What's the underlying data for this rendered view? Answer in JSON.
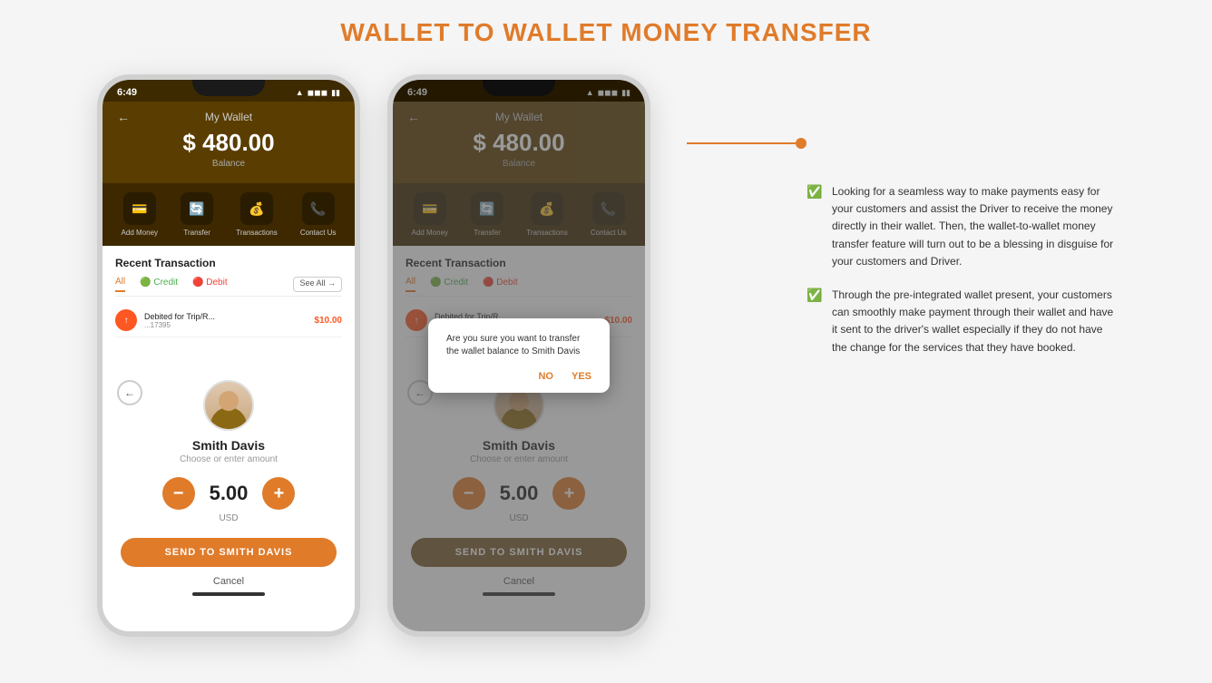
{
  "page": {
    "title": "WALLET TO WALLET MONEY TRANSFER"
  },
  "phone1": {
    "time": "6:49",
    "wallet_title": "My Wallet",
    "amount": "$ 480.00",
    "balance_label": "Balance",
    "actions": [
      {
        "icon": "💳",
        "label": "Add Money"
      },
      {
        "icon": "🔄",
        "label": "Transfer"
      },
      {
        "icon": "💰",
        "label": "Transactions"
      },
      {
        "icon": "📞",
        "label": "Contact Us"
      }
    ],
    "recent_title": "Recent Transaction",
    "tabs": [
      "All",
      "Credit",
      "Debit"
    ],
    "see_all": "See All",
    "transactions": [
      {
        "title": "Debited for Trip/R...",
        "id": "...17395",
        "amount": "$10.00"
      }
    ],
    "person_name": "Smith Davis",
    "choose_amount": "Choose or enter amount",
    "amount_value": "5.00",
    "currency": "USD",
    "send_btn": "SEND TO SMITH DAVIS",
    "cancel": "Cancel"
  },
  "phone2": {
    "time": "6:49",
    "wallet_title": "My Wallet",
    "amount": "$ 480.00",
    "balance_label": "Balance",
    "actions": [
      {
        "icon": "💳",
        "label": "Add Money"
      },
      {
        "icon": "🔄",
        "label": "Transfer"
      },
      {
        "icon": "💰",
        "label": "Transactions"
      },
      {
        "icon": "📞",
        "label": "Contact Us"
      }
    ],
    "recent_title": "Recent Transaction",
    "tabs": [
      "All",
      "Credit",
      "Debit"
    ],
    "transactions": [
      {
        "title": "Debited for Trip/R...",
        "id": "...17395",
        "amount": "$10.00"
      }
    ],
    "person_name": "Smith Davis",
    "choose_amount": "Choose or enter amount",
    "amount_value": "5.00",
    "currency": "USD",
    "send_btn": "SEND TO SMITH DAVIS",
    "cancel": "Cancel",
    "dialog": {
      "text": "Are you sure you want to transfer the wallet balance to Smith Davis",
      "no": "NO",
      "yes": "YES"
    }
  },
  "info": {
    "points": [
      {
        "text": "Looking for a seamless way to make payments easy for your customers and assist the Driver to receive the money directly in their wallet. Then, the wallet-to-wallet money transfer feature will turn out to be a blessing in disguise for your customers and Driver."
      },
      {
        "text": "Through the pre-integrated wallet present, your customers can smoothly make payment through their wallet and have it sent to the driver's wallet especially if they do not have the change for the services that they have booked."
      }
    ]
  }
}
